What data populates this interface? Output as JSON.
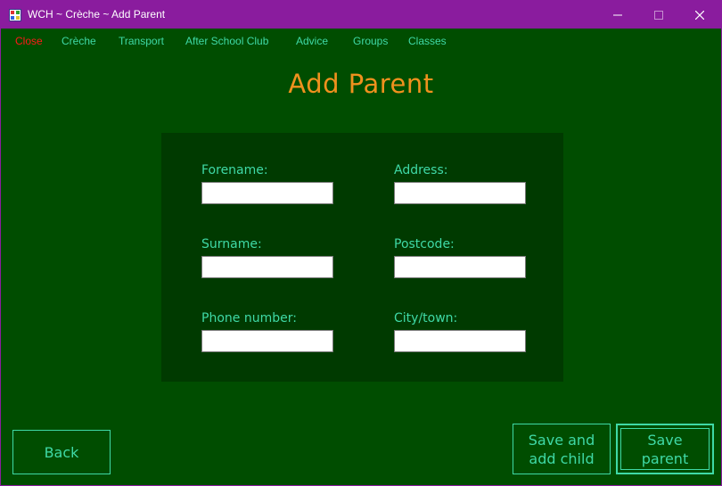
{
  "window": {
    "title": "WCH ~ Crèche ~ Add Parent",
    "controls": {
      "minimize": "minimize",
      "maximize": "maximize",
      "close": "close"
    }
  },
  "menu": {
    "items": [
      {
        "label": "Close"
      },
      {
        "label": "Crèche"
      },
      {
        "label": "Transport"
      },
      {
        "label": "After School Club"
      },
      {
        "label": "Advice"
      },
      {
        "label": "Groups"
      },
      {
        "label": "Classes"
      }
    ]
  },
  "page": {
    "title": "Add Parent"
  },
  "form": {
    "forename": {
      "label": "Forename:",
      "value": ""
    },
    "surname": {
      "label": "Surname:",
      "value": ""
    },
    "phone": {
      "label": "Phone number:",
      "value": ""
    },
    "address": {
      "label": "Address:",
      "value": ""
    },
    "postcode": {
      "label": "Postcode:",
      "value": ""
    },
    "city": {
      "label": "City/town:",
      "value": ""
    }
  },
  "buttons": {
    "back": "Back",
    "save_and_add_child": "Save and\nadd child",
    "save_parent": "Save\nparent"
  },
  "colors": {
    "background": "#004d00",
    "panel": "#003a00",
    "titlebar": "#8a1c9e",
    "accent_text": "#3fd9a6",
    "title_orange": "#f0911e",
    "close_red": "#ff1a1a"
  },
  "icons": {
    "app": "application-icon",
    "minimize": "minimize-icon",
    "maximize": "maximize-icon",
    "close": "close-icon"
  }
}
